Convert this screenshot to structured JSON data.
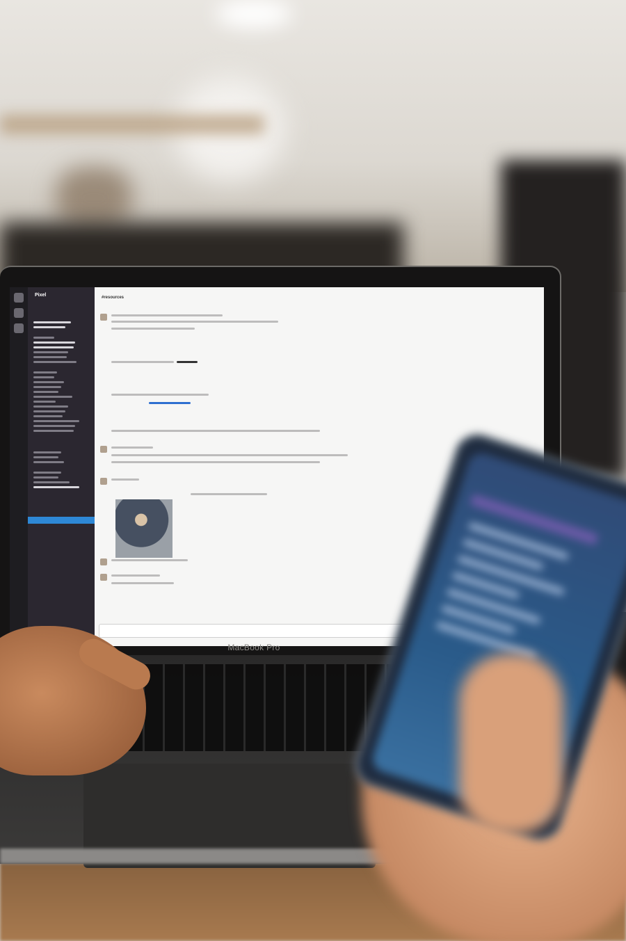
{
  "laptop": {
    "brand_label": "MacBook Pro"
  },
  "slack": {
    "workspace_name": "Pixel",
    "channel_header": "#resources"
  },
  "colors": {
    "sidebar": "#2b2730",
    "active_channel": "#2e88d6",
    "phone_accent": "#6a5aa6"
  }
}
